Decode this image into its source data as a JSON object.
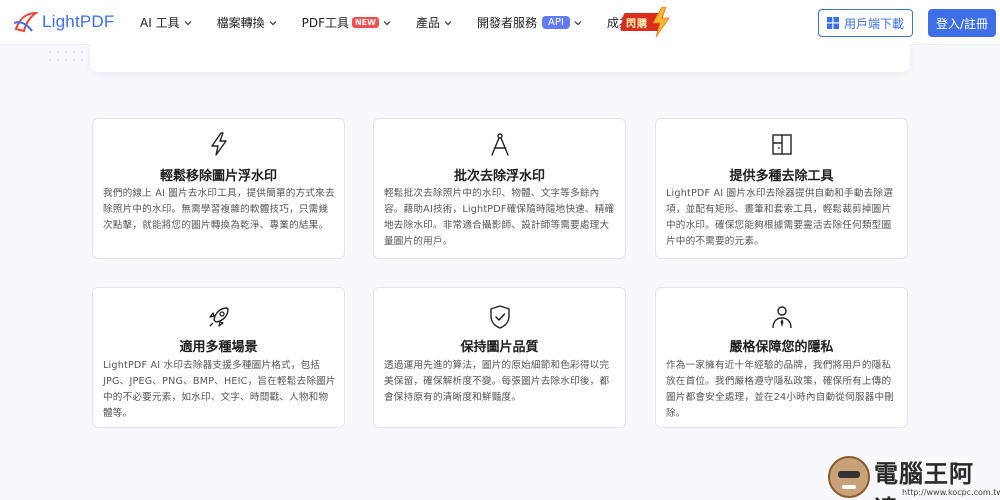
{
  "header": {
    "logo_text": "LightPDF",
    "nav": [
      {
        "label": "AI 工具"
      },
      {
        "label": "檔案轉換"
      },
      {
        "label": "PDF工具",
        "badge": "NEW"
      },
      {
        "label": "產品"
      },
      {
        "label": "開發者服務",
        "badge": "API"
      },
      {
        "label": "成為會員"
      }
    ],
    "hot_badge": "閃購",
    "download_label": "用戶端下載",
    "login_label": "登入/註冊"
  },
  "cards": [
    {
      "icon": "lightning-icon",
      "title": "輕鬆移除圖片浮水印",
      "desc": "我們的線上 AI 圖片去水印工具，提供簡單的方式來去除照片中的水印。無需學習複雜的軟體技巧，只需幾次點擊，就能將您的圖片轉換為乾淨、專業的結果。"
    },
    {
      "icon": "compass-icon",
      "title": "批次去除浮水印",
      "desc": "輕鬆批次去除照片中的水印、物體、文字等多餘內容。藉助AI技術，LightPDF確保隨時隨地快速、精確地去除水印。非常適合攝影師、設計師等需要處理大量圖片的用戶。"
    },
    {
      "icon": "door-icon",
      "title": "提供多種去除工具",
      "desc": "LightPDF AI 圖片水印去除器提供自動和手動去除選項，並配有矩形、畫筆和套索工具，輕鬆裁剪掉圖片中的水印。確保您能夠根據需要靈活去除任何類型圖片中的不需要的元素。"
    },
    {
      "icon": "rocket-icon",
      "title": "適用多種場景",
      "desc": "LightPDF AI 水印去除器支援多種圖片格式，包括JPG、JPEG、PNG、BMP、HEIC，旨在輕鬆去除圖片中的不必要元素，如水印、文字、時間戳、人物和物體等。"
    },
    {
      "icon": "shield-check-icon",
      "title": "保持圖片品質",
      "desc": "透過運用先進的算法，圖片的原始細節和色彩得以完美保留，確保解析度不變。每張圖片去除水印後，都會保持原有的清晰度和鮮豔度。"
    },
    {
      "icon": "person-icon",
      "title": "嚴格保障您的隱私",
      "desc": "作為一家擁有近十年經驗的品牌，我們將用戶的隱私放在首位。我們嚴格遵守隱私政策，確保所有上傳的圖片都會安全處理，並在24小時內自動從伺服器中刪除。"
    }
  ],
  "watermark": {
    "title": "電腦王阿達",
    "url": "http://www.kocpc.com.tw"
  },
  "colors": {
    "brand": "#3f6fe6",
    "page_bg": "#f7f8fb",
    "card_border": "#e2e5ec"
  }
}
